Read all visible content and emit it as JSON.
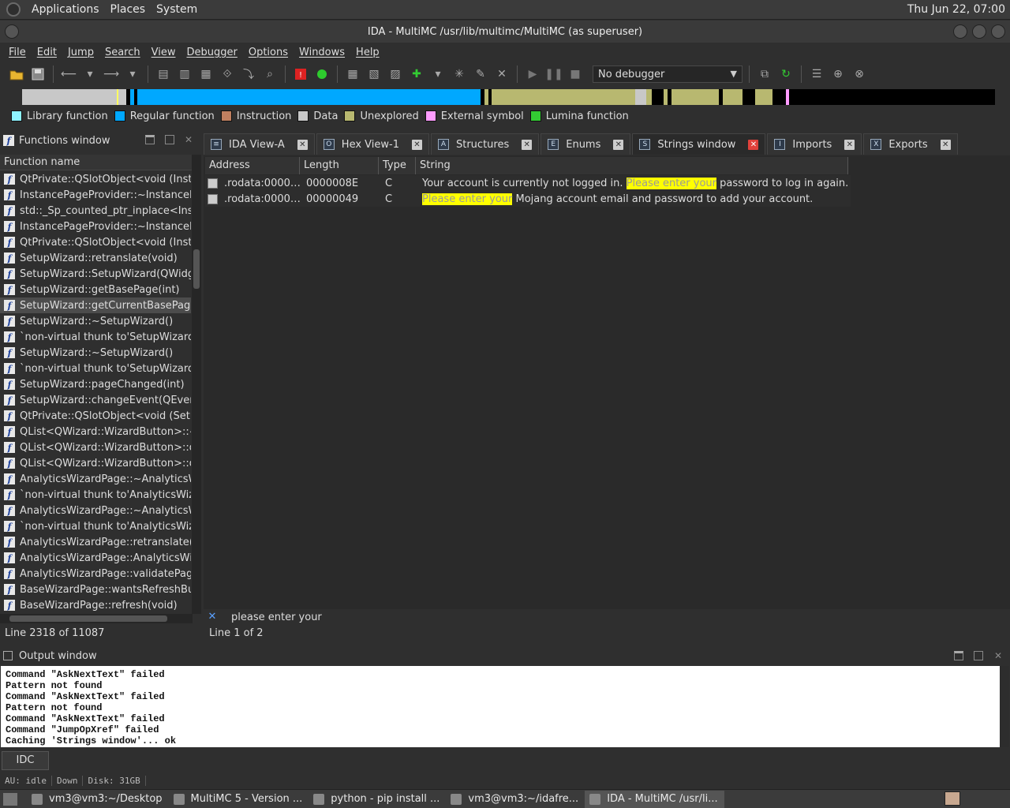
{
  "gnome_panel": {
    "menus": [
      "Applications",
      "Places",
      "System"
    ],
    "clock": "Thu Jun 22, 07:00"
  },
  "window": {
    "title": "IDA - MultiMC /usr/lib/multimc/MultiMC (as superuser)"
  },
  "menubar": [
    "File",
    "Edit",
    "Jump",
    "Search",
    "View",
    "Debugger",
    "Options",
    "Windows",
    "Help"
  ],
  "toolbar": {
    "debugger_select": "No debugger"
  },
  "legend": [
    {
      "label": "Library function",
      "color": "#8ef3ff"
    },
    {
      "label": "Regular function",
      "color": "#00a8ff"
    },
    {
      "label": "Instruction",
      "color": "#c08060"
    },
    {
      "label": "Data",
      "color": "#c8c8c8"
    },
    {
      "label": "Unexplored",
      "color": "#b8b870"
    },
    {
      "label": "External symbol",
      "color": "#ff9cff"
    },
    {
      "label": "Lumina function",
      "color": "#33cc33"
    }
  ],
  "functions_window": {
    "title": "Functions window",
    "column": "Function name",
    "selected_index": 8,
    "items": [
      "QtPrivate::QSlotObject<void (Instanc",
      "InstancePageProvider::~InstancePage",
      "std::_Sp_counted_ptr_inplace<Instan",
      "InstancePageProvider::~InstancePage",
      "QtPrivate::QSlotObject<void (Instanc",
      "SetupWizard::retranslate(void)",
      "SetupWizard::SetupWizard(QWidget",
      "SetupWizard::getBasePage(int)",
      "SetupWizard::getCurrentBasePage(vo",
      "SetupWizard::~SetupWizard()",
      "`non-virtual thunk to'SetupWizard::~",
      "SetupWizard::~SetupWizard()",
      "`non-virtual thunk to'SetupWizard::~",
      "SetupWizard::pageChanged(int)",
      "SetupWizard::changeEvent(QEvent *)",
      "QtPrivate::QSlotObject<void (SetupW",
      "QList<QWizard::WizardButton>::~QL",
      "QList<QWizard::WizardButton>::deta",
      "QList<QWizard::WizardButton>::deta",
      "AnalyticsWizardPage::~AnalyticsWiza",
      "`non-virtual thunk to'AnalyticsWizarc",
      "AnalyticsWizardPage::~AnalyticsWiza",
      "`non-virtual thunk to'AnalyticsWizarc",
      "AnalyticsWizardPage::retranslate(voi",
      "AnalyticsWizardPage::AnalyticsWizar",
      "AnalyticsWizardPage::validatePage(vo",
      "BaseWizardPage::wantsRefreshButto",
      "BaseWizardPage::refresh(void)"
    ],
    "status": "Line 2318 of 11087"
  },
  "tabs": [
    {
      "label": "IDA View-A",
      "icon": "listing-icon",
      "glyph": "≡"
    },
    {
      "label": "Hex View-1",
      "icon": "hex-icon",
      "glyph": "O"
    },
    {
      "label": "Structures",
      "icon": "structures-icon",
      "glyph": "A"
    },
    {
      "label": "Enums",
      "icon": "enums-icon",
      "glyph": "E"
    },
    {
      "label": "Strings window",
      "icon": "strings-icon",
      "glyph": "S",
      "active": true
    },
    {
      "label": "Imports",
      "icon": "imports-icon",
      "glyph": "I"
    },
    {
      "label": "Exports",
      "icon": "exports-icon",
      "glyph": "X"
    }
  ],
  "strings_window": {
    "columns": [
      "Address",
      "Length",
      "Type",
      "String"
    ],
    "rows": [
      {
        "address": ".rodata:0000…",
        "length": "0000008E",
        "type": "C",
        "string_before": "Your account is currently not logged in. ",
        "string_highlight": "Please enter your",
        "string_after": " password to log in again. <br /> <b…"
      },
      {
        "address": ".rodata:0000…",
        "length": "00000049",
        "type": "C",
        "string_before": "",
        "string_highlight": "Please enter your",
        "string_after": " Mojang account email and password to add your account."
      }
    ],
    "search_text": "please enter your",
    "status": "Line 1 of 2"
  },
  "output_window": {
    "title": "Output window",
    "lines": [
      "Command \"AskNextText\" failed",
      "Pattern not found",
      "Command \"AskNextText\" failed",
      "Pattern not found",
      "Command \"AskNextText\" failed",
      "Command \"JumpOpXref\" failed",
      "Caching 'Strings window'... ok"
    ],
    "idc_button": "IDC"
  },
  "statusbar": [
    "AU:  idle",
    "Down",
    "Disk: 31GB"
  ],
  "taskbar": [
    {
      "label": "vm3@vm3:~/Desktop",
      "icon": "terminal-icon"
    },
    {
      "label": "MultiMC 5 - Version ...",
      "icon": "multimc-icon"
    },
    {
      "label": "python - pip install ...",
      "icon": "chrome-icon"
    },
    {
      "label": "vm3@vm3:~/idafre...",
      "icon": "terminal-icon"
    },
    {
      "label": "IDA - MultiMC /usr/li...",
      "icon": "ida-icon",
      "active": true
    }
  ],
  "navband_segments": [
    {
      "color": "#c8c8c8",
      "w": 0.1
    },
    {
      "color": "#ffff60",
      "w": 0.002
    },
    {
      "color": "#c8c8c8",
      "w": 0.008
    },
    {
      "color": "#000000",
      "w": 0.004
    },
    {
      "color": "#00a8ff",
      "w": 0.004
    },
    {
      "color": "#000000",
      "w": 0.003
    },
    {
      "color": "#00a8ff",
      "w": 0.36
    },
    {
      "color": "#000000",
      "w": 0.004
    },
    {
      "color": "#b8b870",
      "w": 0.004
    },
    {
      "color": "#000000",
      "w": 0.004
    },
    {
      "color": "#b8b870",
      "w": 0.15
    },
    {
      "color": "#c8c8c8",
      "w": 0.012
    },
    {
      "color": "#b8b870",
      "w": 0.006
    },
    {
      "color": "#000000",
      "w": 0.012
    },
    {
      "color": "#b8b870",
      "w": 0.004
    },
    {
      "color": "#000000",
      "w": 0.004
    },
    {
      "color": "#b8b870",
      "w": 0.05
    },
    {
      "color": "#000000",
      "w": 0.004
    },
    {
      "color": "#b8b870",
      "w": 0.02
    },
    {
      "color": "#000000",
      "w": 0.014
    },
    {
      "color": "#b8b870",
      "w": 0.018
    },
    {
      "color": "#000000",
      "w": 0.014
    },
    {
      "color": "#ff9cff",
      "w": 0.004
    },
    {
      "color": "#000000",
      "w": 0.216
    }
  ]
}
